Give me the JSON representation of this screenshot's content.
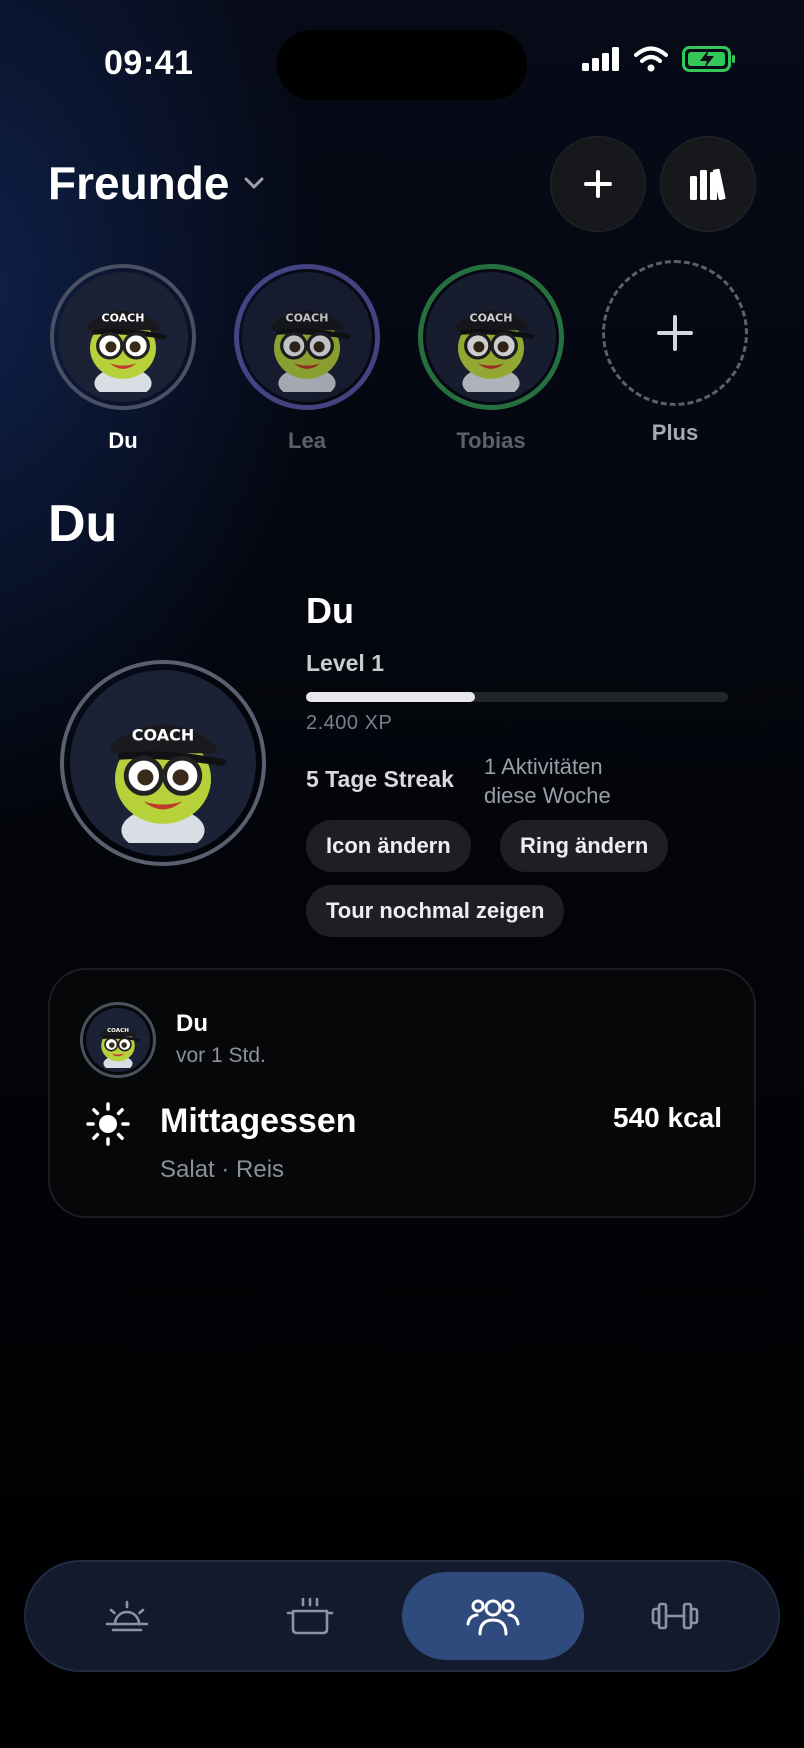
{
  "status_bar": {
    "time": "09:41",
    "icons": [
      "signal-icon",
      "wifi-icon",
      "battery-charging-icon"
    ]
  },
  "header": {
    "title": "Freunde",
    "add_icon": "plus-icon",
    "stats_icon": "library-icon"
  },
  "friends": [
    {
      "name": "Du",
      "ring_color": "#4a5063",
      "muted": false
    },
    {
      "name": "Lea",
      "ring_color": "#5a56a6",
      "muted": true
    },
    {
      "name": "Tobias",
      "ring_color": "#2f8a4c",
      "muted": true
    },
    {
      "name": "Plus",
      "add": true
    }
  ],
  "section": {
    "title": "Du"
  },
  "profile": {
    "name": "Du",
    "level": "Level 1",
    "xp": "2.400 XP",
    "xp_progress_fraction": 0.4,
    "streak": "5 Tage Streak",
    "activity_line1": "1 Aktivitäten",
    "activity_line2": "diese Woche",
    "actions": {
      "change_icon": "Icon ändern",
      "change_ring": "Ring ändern",
      "tour": "Tour nochmal zeigen"
    }
  },
  "feed": [
    {
      "user": "Du",
      "time": "vor 1 Std.",
      "meal": "Mittagessen",
      "items": "Salat · Reis",
      "kcal": "540 kcal",
      "icon": "sun-icon"
    }
  ],
  "nav": [
    {
      "icon": "sunrise-icon",
      "active": false
    },
    {
      "icon": "cooking-pot-icon",
      "active": false
    },
    {
      "icon": "friends-icon",
      "active": true
    },
    {
      "icon": "dumbbell-icon",
      "active": false
    }
  ],
  "colors": {
    "accent": "#2f4a7c",
    "xp_fill": "#e7e8ea",
    "mascot": "#b7d13a"
  }
}
